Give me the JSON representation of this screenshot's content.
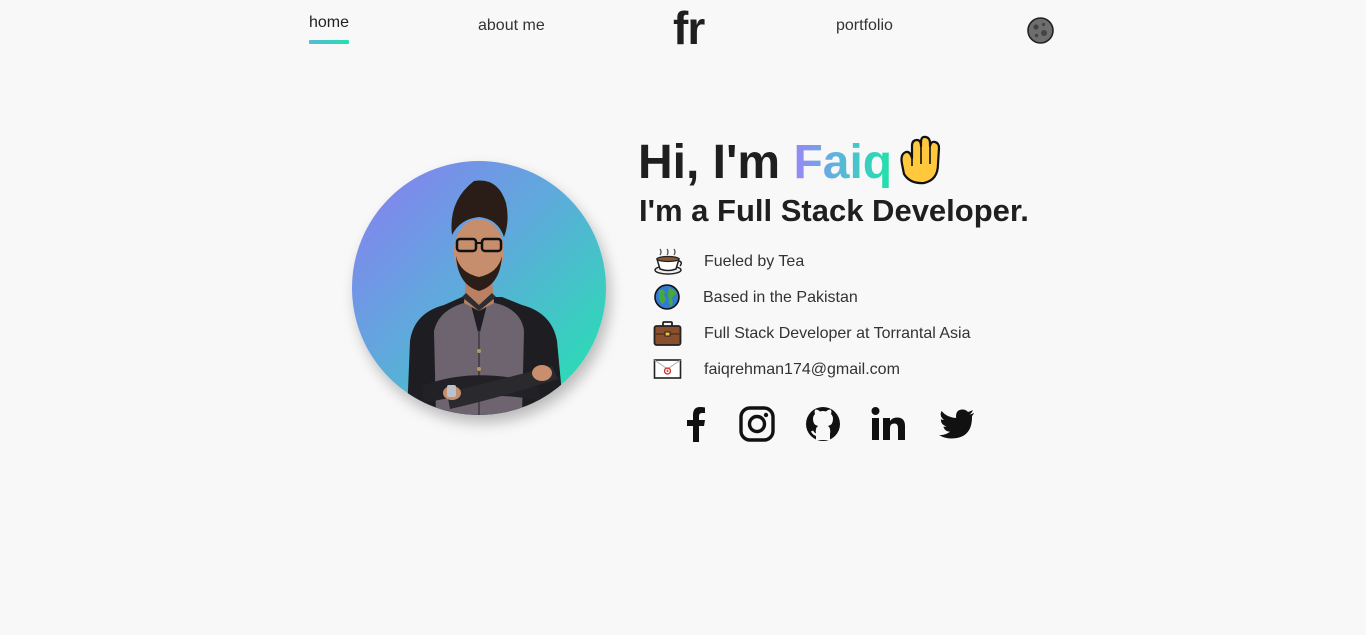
{
  "nav": {
    "home_label": "home",
    "about_label": "about me",
    "logo_text": "fr",
    "portfolio_label": "portfolio",
    "theme_toggle_icon": "moon-icon"
  },
  "hero": {
    "greeting_prefix": "Hi, I'm ",
    "name": "Faiq",
    "wave_icon": "waving-hand-icon",
    "subtitle": "I'm a Full Stack Developer.",
    "avatar_icon": "profile-photo",
    "info": [
      {
        "icon": "tea-cup-icon",
        "text": "Fueled by Tea"
      },
      {
        "icon": "globe-icon",
        "text": "Based in the Pakistan"
      },
      {
        "icon": "briefcase-icon",
        "text": "Full Stack Developer at Torrantal Asia"
      },
      {
        "icon": "envelope-icon",
        "text": "faiqrehman174@gmail.com"
      }
    ],
    "social": [
      {
        "icon": "facebook-icon"
      },
      {
        "icon": "instagram-icon"
      },
      {
        "icon": "github-icon"
      },
      {
        "icon": "linkedin-icon"
      },
      {
        "icon": "twitter-icon"
      }
    ]
  },
  "colors": {
    "background": "#f8f8f8",
    "gradient_start": "#8b7cf3",
    "gradient_mid": "#5fa9dc",
    "gradient_end": "#1ee8ac",
    "text": "#1f1f1f"
  }
}
